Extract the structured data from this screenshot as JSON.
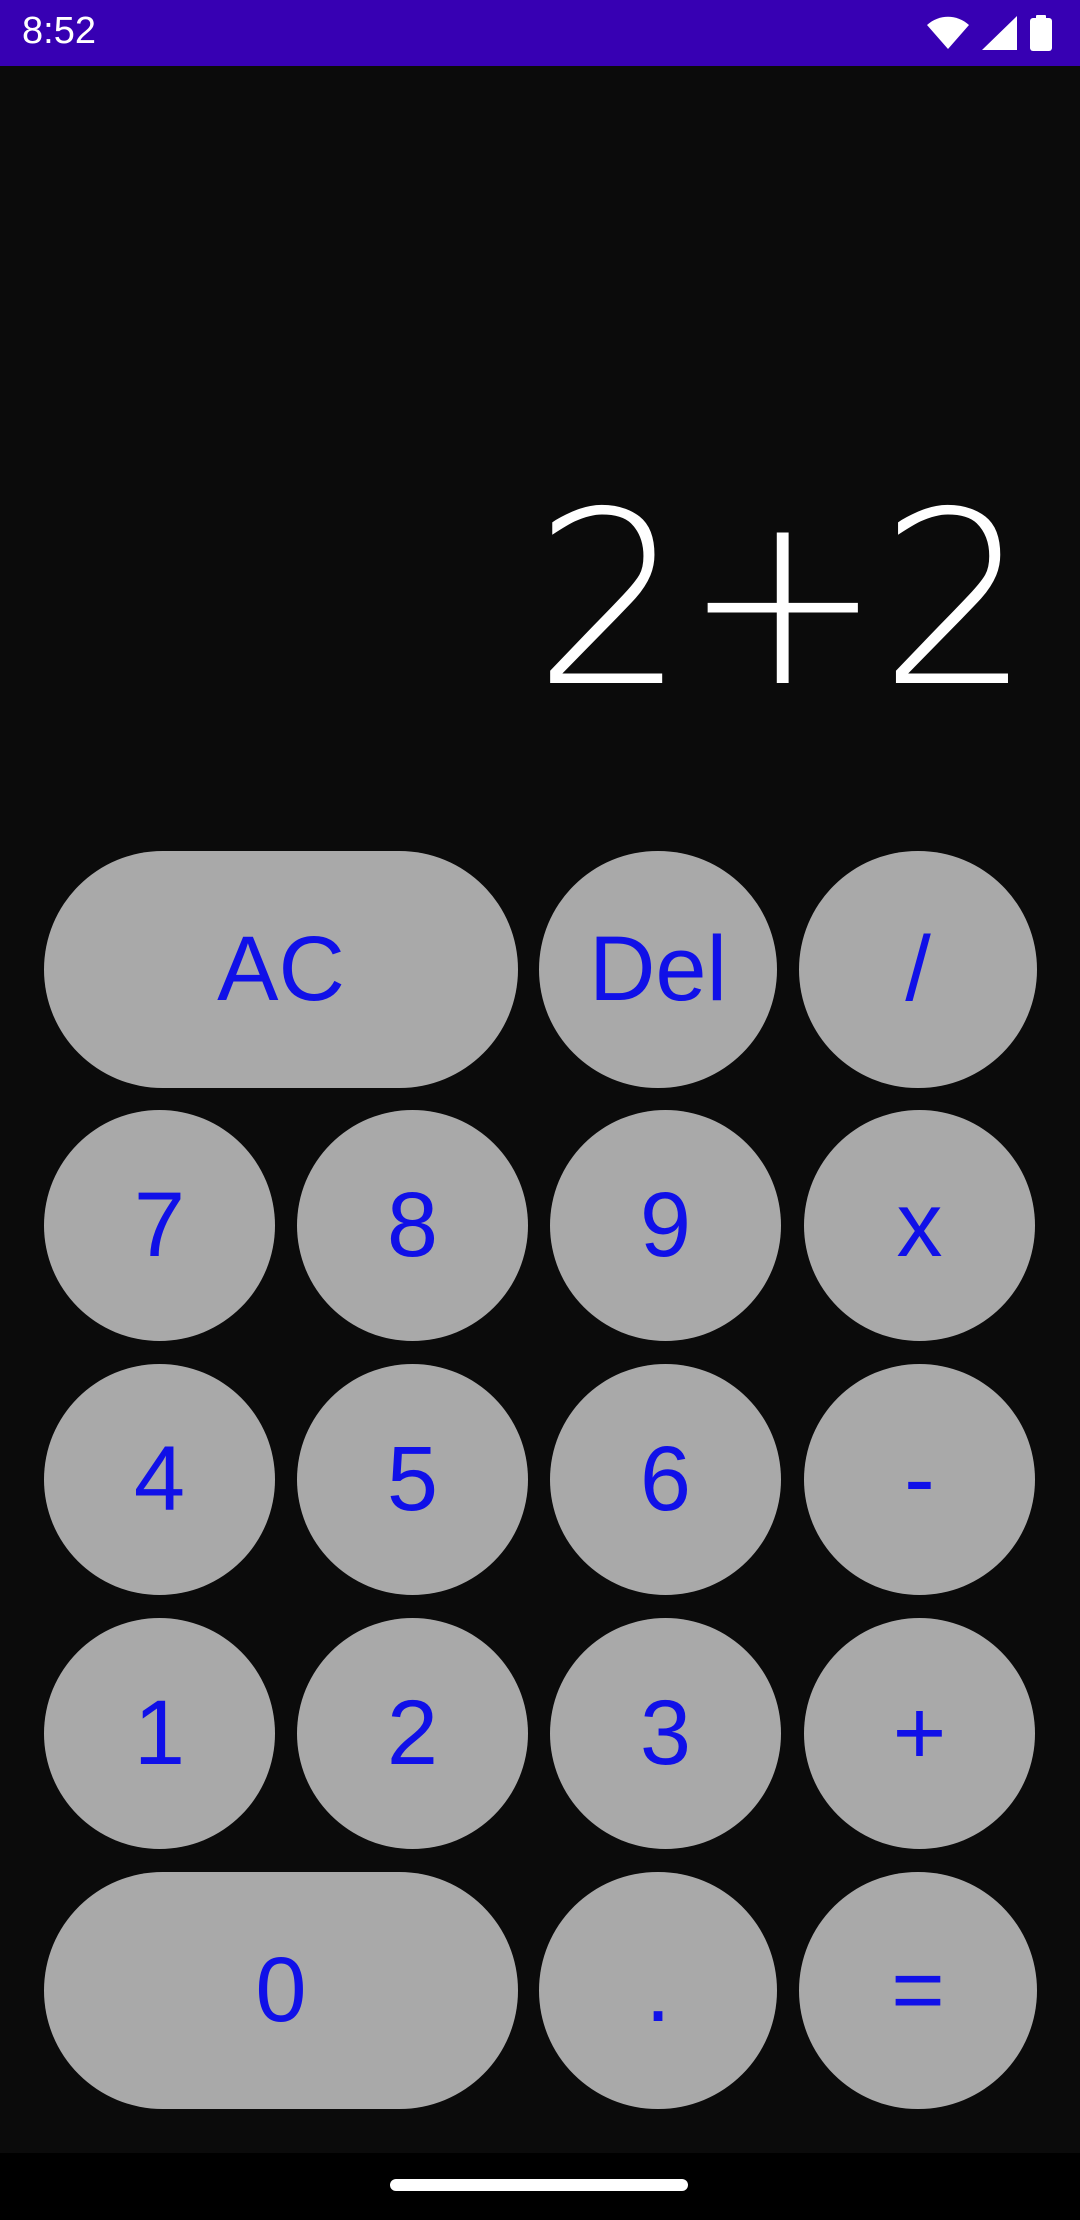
{
  "status_bar": {
    "time": "8:52",
    "bg_color": "#3700b3"
  },
  "display": {
    "expression": "2+2"
  },
  "keypad": {
    "key_color": "#a9a9a9",
    "label_color": "#1010e8",
    "ac": "AC",
    "del": "Del",
    "divide": "/",
    "seven": "7",
    "eight": "8",
    "nine": "9",
    "multiply": "x",
    "four": "4",
    "five": "5",
    "six": "6",
    "minus": "-",
    "one": "1",
    "two": "2",
    "three": "3",
    "plus": "+",
    "zero": "0",
    "dot": ".",
    "equals": "="
  },
  "icons": {
    "wifi": "wifi-icon",
    "signal": "signal-icon",
    "battery": "battery-icon"
  }
}
